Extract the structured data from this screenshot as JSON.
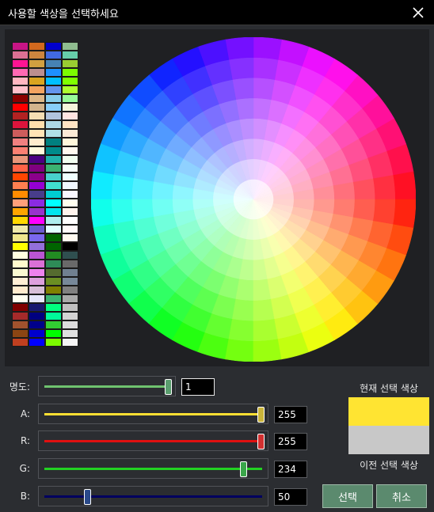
{
  "window": {
    "title": "사용할 색상을 선택하세요",
    "close_icon": "close-icon"
  },
  "palette_colors": [
    "#c71585",
    "#d2691e",
    "#0000cd",
    "#8fbc8f",
    "#db7093",
    "#cd853f",
    "#4169e1",
    "#66cdaa",
    "#ff1493",
    "#d2a040",
    "#4682b4",
    "#9acd32",
    "#ff69b4",
    "#bc8f8f",
    "#1e90ff",
    "#7cfc00",
    "#ffb6c1",
    "#daa520",
    "#00bfff",
    "#7fff00",
    "#ffc0cb",
    "#f4a460",
    "#6495ed",
    "#adff2f",
    "#8b0000",
    "#deb887",
    "#87ceeb",
    "#98fb98",
    "#ff0000",
    "#d2b48c",
    "#87cefa",
    "#f5f5dc",
    "#b22222",
    "#f5deb3",
    "#b0c4de",
    "#ffe4e1",
    "#dc143c",
    "#ffdead",
    "#add8e6",
    "#ffe4c4",
    "#cd5c5c",
    "#ffe4b5",
    "#b0e0e6",
    "#faebd7",
    "#f08080",
    "#ffebcd",
    "#008080",
    "#fff8dc",
    "#fa8072",
    "#fff8dc",
    "#008b8b",
    "#fffaf0",
    "#e9967a",
    "#4b0082",
    "#20b2aa",
    "#f0fff0",
    "#ff6347",
    "#800080",
    "#3cb371",
    "#f5fffa",
    "#ff4500",
    "#8b008b",
    "#48d1cc",
    "#f0ffff",
    "#ff7f50",
    "#9400d3",
    "#40e0d0",
    "#f0f8ff",
    "#ff8c00",
    "#483d8b",
    "#00ced1",
    "#f8f8ff",
    "#ffa07a",
    "#8a2be2",
    "#00ffff",
    "#fffff0",
    "#ffa500",
    "#9932cc",
    "#00e5ee",
    "#fff5ee",
    "#ffd700",
    "#ff00ff",
    "#afeeee",
    "#ffffff",
    "#eee8aa",
    "#6a5acd",
    "#e0ffff",
    "#fffafa",
    "#f0e68c",
    "#7b68ee",
    "#006400",
    "#fffaf0",
    "#ffff00",
    "#9370db",
    "#006400",
    "#000000",
    "#ffffe0",
    "#ba55d3",
    "#228b22",
    "#2f4f4f",
    "#fffacd",
    "#da70d6",
    "#2e8b57",
    "#696969",
    "#fafad2",
    "#ee82ee",
    "#556b2f",
    "#708090",
    "#ffefd5",
    "#dda0dd",
    "#6b8e23",
    "#778899",
    "#ffebcd",
    "#d8bfd8",
    "#808000",
    "#808080",
    "#fffff0",
    "#e6e6fa",
    "#3cb371",
    "#a9a9a9",
    "#800000",
    "#191970",
    "#00ff7f",
    "#c0c0c0",
    "#a52a2a",
    "#000080",
    "#00fa9a",
    "#d3d3d3",
    "#a0522d",
    "#00008b",
    "#32cd32",
    "#dcdcdc",
    "#8b4513",
    "#0000cd",
    "#00ff00",
    "#e0e0e0",
    "#c04020",
    "#0000ff",
    "#7cfc00",
    "#f5f5f5"
  ],
  "brightness": {
    "label": "명도:",
    "value": "1",
    "level": 1.0
  },
  "sliders": [
    {
      "key": "a",
      "label": "A:",
      "value": "255",
      "level": 1.0,
      "track_color": "#ffe033"
    },
    {
      "key": "r",
      "label": "R:",
      "value": "255",
      "level": 1.0,
      "track_color": "#e01010"
    },
    {
      "key": "g",
      "label": "G:",
      "value": "234",
      "level": 0.918,
      "track_color": "#22d022"
    },
    {
      "key": "b",
      "label": "B:",
      "value": "50",
      "level": 0.196,
      "track_color": "#000060"
    }
  ],
  "current_color": {
    "label": "현재 선택 색상",
    "hex": "#ffe432"
  },
  "previous_color": {
    "label": "이전 선택 색상",
    "hex": "#c8c8c8"
  },
  "buttons": {
    "select": "선택",
    "cancel": "취소"
  },
  "colors": {
    "button_bg": "#5b8a6e",
    "panel_bg": "#1f2023",
    "window_bg": "#2b2d31"
  }
}
